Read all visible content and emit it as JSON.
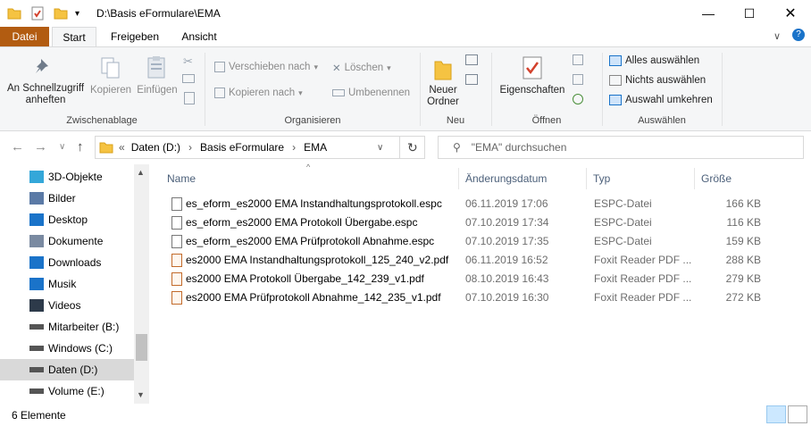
{
  "window": {
    "path_title": "D:\\Basis eFormulare\\EMA"
  },
  "ribbon_tabs": [
    "Datei",
    "Start",
    "Freigeben",
    "Ansicht"
  ],
  "ribbon": {
    "clipboard": {
      "pin_label": "An Schnellzugriff\nanheften",
      "copy_label": "Kopieren",
      "paste_label": "Einfügen",
      "group": "Zwischenablage"
    },
    "organize": {
      "move_label": "Verschieben nach",
      "copyto_label": "Kopieren nach",
      "delete_label": "Löschen",
      "rename_label": "Umbenennen",
      "group": "Organisieren"
    },
    "new": {
      "newfolder_label": "Neuer\nOrdner",
      "group": "Neu"
    },
    "open": {
      "properties_label": "Eigenschaften",
      "group": "Öffnen"
    },
    "select": {
      "select_all": "Alles auswählen",
      "select_none": "Nichts auswählen",
      "invert": "Auswahl umkehren",
      "group": "Auswählen"
    }
  },
  "address": {
    "crumbs": [
      "Daten (D:)",
      "Basis eFormulare",
      "EMA"
    ],
    "search_placeholder": "\"EMA\" durchsuchen"
  },
  "nav_items": [
    {
      "label": "3D-Objekte",
      "icon": "cube-icon"
    },
    {
      "label": "Bilder",
      "icon": "pictures-icon"
    },
    {
      "label": "Desktop",
      "icon": "desktop-icon"
    },
    {
      "label": "Dokumente",
      "icon": "documents-icon"
    },
    {
      "label": "Downloads",
      "icon": "download-icon"
    },
    {
      "label": "Musik",
      "icon": "music-icon"
    },
    {
      "label": "Videos",
      "icon": "video-icon"
    },
    {
      "label": "Mitarbeiter (B:)",
      "icon": "network-drive-icon"
    },
    {
      "label": "Windows (C:)",
      "icon": "drive-icon"
    },
    {
      "label": "Daten (D:)",
      "icon": "drive-icon"
    },
    {
      "label": "Volume (E:)",
      "icon": "drive-icon"
    }
  ],
  "columns": {
    "name": "Name",
    "date": "Änderungsdatum",
    "type": "Typ",
    "size": "Größe"
  },
  "files": [
    {
      "name": "es_eform_es2000 EMA Instandhaltungsprotokoll.espc",
      "date": "06.11.2019 17:06",
      "type": "ESPC-Datei",
      "size": "166 KB",
      "kind": "espc"
    },
    {
      "name": "es_eform_es2000 EMA Protokoll Übergabe.espc",
      "date": "07.10.2019 17:34",
      "type": "ESPC-Datei",
      "size": "116 KB",
      "kind": "espc"
    },
    {
      "name": "es_eform_es2000 EMA Prüfprotokoll Abnahme.espc",
      "date": "07.10.2019 17:35",
      "type": "ESPC-Datei",
      "size": "159 KB",
      "kind": "espc"
    },
    {
      "name": "es2000 EMA Instandhaltungsprotokoll_125_240_v2.pdf",
      "date": "06.11.2019 16:52",
      "type": "Foxit Reader PDF ...",
      "size": "288 KB",
      "kind": "pdf"
    },
    {
      "name": "es2000 EMA Protokoll Übergabe_142_239_v1.pdf",
      "date": "08.10.2019 16:43",
      "type": "Foxit Reader PDF ...",
      "size": "279 KB",
      "kind": "pdf"
    },
    {
      "name": "es2000 EMA Prüfprotokoll Abnahme_142_235_v1.pdf",
      "date": "07.10.2019 16:30",
      "type": "Foxit Reader PDF ...",
      "size": "272 KB",
      "kind": "pdf"
    }
  ],
  "status": {
    "count": "6 Elemente"
  },
  "colors": {
    "file_tab": "#b25c11",
    "folder": "#f5c342",
    "selected_nav": "#d9d9d9"
  }
}
